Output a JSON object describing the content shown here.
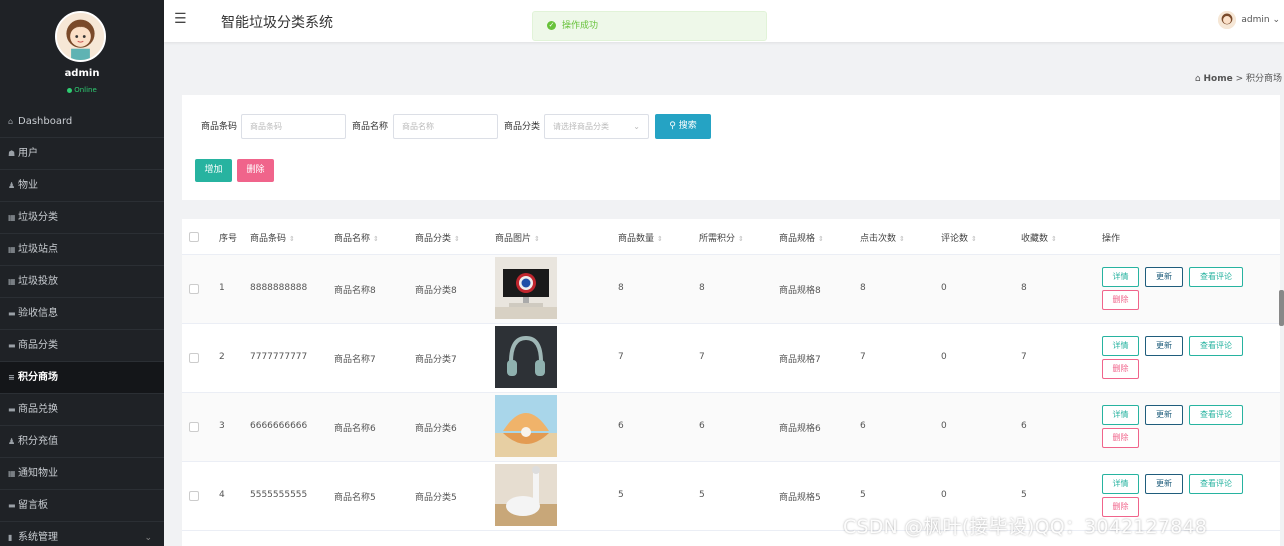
{
  "app": {
    "title": "智能垃圾分类系统"
  },
  "user": {
    "name": "admin",
    "status": "Online"
  },
  "toast": {
    "message": "操作成功"
  },
  "topbar": {
    "username": "admin",
    "caret": "⌄"
  },
  "sidebar": {
    "items": [
      {
        "label": "Dashboard",
        "icon": "home-icon",
        "glyph": "⌂"
      },
      {
        "label": "用户",
        "icon": "user-icon",
        "glyph": "☗"
      },
      {
        "label": "物业",
        "icon": "person-icon",
        "glyph": "♟"
      },
      {
        "label": "垃圾分类",
        "icon": "grid-icon",
        "glyph": "▦"
      },
      {
        "label": "垃圾站点",
        "icon": "grid-icon",
        "glyph": "▦"
      },
      {
        "label": "垃圾投放",
        "icon": "grid-icon",
        "glyph": "▦"
      },
      {
        "label": "验收信息",
        "icon": "card-icon",
        "glyph": "▬"
      },
      {
        "label": "商品分类",
        "icon": "card-icon",
        "glyph": "▬"
      },
      {
        "label": "积分商场",
        "icon": "list-icon",
        "glyph": "≡",
        "active": true
      },
      {
        "label": "商品兑换",
        "icon": "card-icon",
        "glyph": "▬"
      },
      {
        "label": "积分充值",
        "icon": "person-icon",
        "glyph": "♟"
      },
      {
        "label": "通知物业",
        "icon": "grid-icon",
        "glyph": "▦"
      },
      {
        "label": "留言板",
        "icon": "card-icon",
        "glyph": "▬"
      },
      {
        "label": "系统管理",
        "icon": "bar-chart-icon",
        "glyph": "▮",
        "chevron": "⌄"
      }
    ]
  },
  "breadcrumb": {
    "home": "Home",
    "separator": ">",
    "current": "积分商场"
  },
  "search": {
    "barcode_label": "商品条码",
    "barcode_placeholder": "商品条码",
    "name_label": "商品名称",
    "name_placeholder": "商品名称",
    "category_label": "商品分类",
    "category_placeholder": "请选择商品分类",
    "search_button": "搜索",
    "add_button": "增加",
    "delete_button": "删除"
  },
  "table": {
    "headers": [
      "序号",
      "商品条码",
      "商品名称",
      "商品分类",
      "商品图片",
      "商品数量",
      "所需积分",
      "商品规格",
      "点击次数",
      "评论数",
      "收藏数",
      "操作"
    ],
    "actions": {
      "detail": "详情",
      "update": "更新",
      "comments": "查看评论",
      "delete": "删除"
    },
    "rows": [
      {
        "index": "1",
        "barcode": "8888888888",
        "name": "商品名称8",
        "category": "商品分类8",
        "quantity": "8",
        "points": "8",
        "spec": "商品规格8",
        "clicks": "8",
        "comments": "0",
        "favorites": "8",
        "image": "monitor-shield"
      },
      {
        "index": "2",
        "barcode": "7777777777",
        "name": "商品名称7",
        "category": "商品分类7",
        "quantity": "7",
        "points": "7",
        "spec": "商品规格7",
        "clicks": "7",
        "comments": "0",
        "favorites": "7",
        "image": "headphones"
      },
      {
        "index": "3",
        "barcode": "6666666666",
        "name": "商品名称6",
        "category": "商品分类6",
        "quantity": "6",
        "points": "6",
        "spec": "商品规格6",
        "clicks": "6",
        "comments": "0",
        "favorites": "6",
        "image": "pearl-shell"
      },
      {
        "index": "4",
        "barcode": "5555555555",
        "name": "商品名称5",
        "category": "商品分类5",
        "quantity": "5",
        "points": "5",
        "spec": "商品规格5",
        "clicks": "5",
        "comments": "0",
        "favorites": "5",
        "image": "robot-vacuum"
      }
    ]
  },
  "watermark": "CSDN @枫叶(接毕设)QQ：3042127848",
  "colors": {
    "sidebar_bg": "#1f2226",
    "primary": "#27b3a0",
    "search": "#25a3c4",
    "danger": "#f0648b",
    "update": "#1f5d7c"
  }
}
